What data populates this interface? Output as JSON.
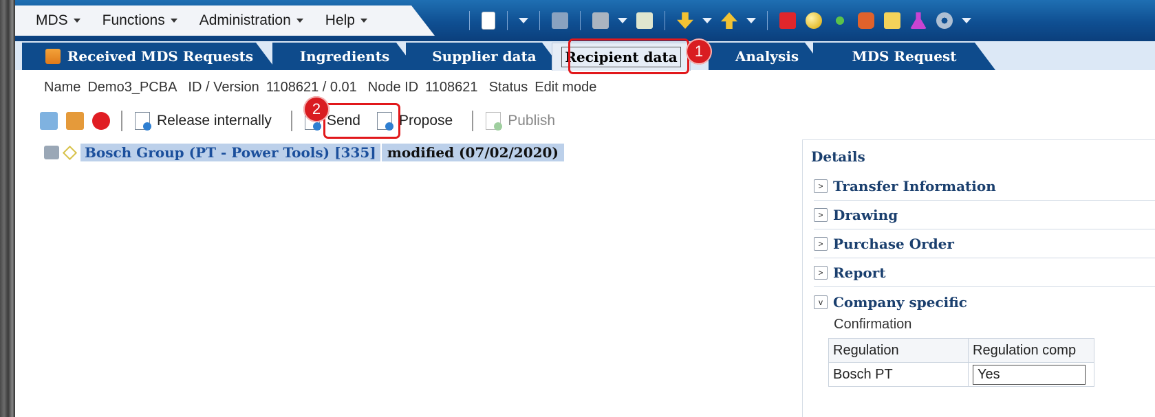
{
  "menu": {
    "items": [
      {
        "label": "MDS"
      },
      {
        "label": "Functions"
      },
      {
        "label": "Administration"
      },
      {
        "label": "Help"
      }
    ]
  },
  "toolbar_icons": [
    "new-document-icon",
    "dropdown-icon",
    "save-icon",
    "print-icon",
    "dropdown-icon",
    "check-document-icon",
    "download-icon",
    "dropdown-icon",
    "upload-icon",
    "dropdown-icon",
    "cube-icon",
    "sphere-icon",
    "molecule-icon",
    "puzzle-icon",
    "folder-icon",
    "flask-icon",
    "gear-icon",
    "dropdown-icon"
  ],
  "tabs": {
    "received": "Received MDS Requests",
    "ingredients": "Ingredients",
    "supplier": "Supplier data",
    "recipient": "Recipient data",
    "analysis": "Analysis",
    "mds_request": "MDS Request"
  },
  "annotations": {
    "badge1": "1",
    "badge2": "2"
  },
  "info": {
    "name_label": "Name",
    "name_value": "Demo3_PCBA",
    "id_label": "ID / Version",
    "id_value": "1108621 / 0.01",
    "node_label": "Node ID",
    "node_value": "1108621",
    "status_label": "Status",
    "status_value": "Edit mode"
  },
  "actions": {
    "release": "Release internally",
    "send": "Send",
    "propose": "Propose",
    "publish": "Publish"
  },
  "tree": {
    "name": "Bosch Group (PT - Power Tools) [335]",
    "status": "modified (07/02/2020)"
  },
  "details": {
    "title": "Details",
    "sections": {
      "transfer": "Transfer Information",
      "drawing": "Drawing",
      "purchase": "Purchase Order",
      "report": "Report",
      "company": "Company specific"
    },
    "confirmation": "Confirmation",
    "table": {
      "headers": [
        "Regulation",
        "Regulation comp"
      ],
      "rows": [
        [
          "Bosch PT",
          "Yes"
        ]
      ]
    }
  },
  "colors": {
    "header_blue": "#0e4b8c",
    "annotation_red": "#e1181b",
    "selection": "#bcd0ea"
  }
}
